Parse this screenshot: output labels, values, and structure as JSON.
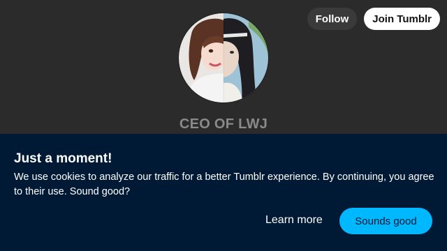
{
  "header": {
    "follow_label": "Follow",
    "join_label": "Join Tumblr"
  },
  "blog": {
    "title": "CEO OF LWJ"
  },
  "cookie_banner": {
    "heading": "Just a moment!",
    "body": "We use cookies to analyze our traffic for a better Tumblr experience. By continuing, you agree to their use. Sound good?",
    "learn_more_label": "Learn more",
    "accept_label": "Sounds good"
  },
  "colors": {
    "page_background": "#2b2b2b",
    "banner_background": "#001935",
    "accent": "#00b8ff"
  }
}
